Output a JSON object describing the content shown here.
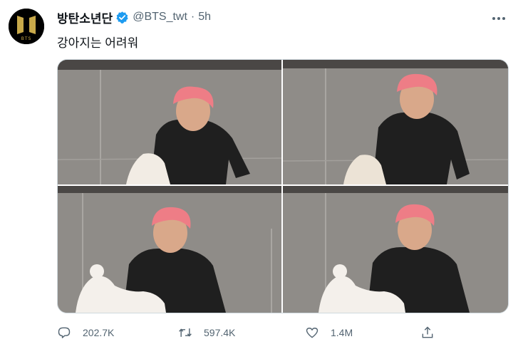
{
  "tweet": {
    "author_name": "방탄소년단",
    "author_handle": "@BTS_twt",
    "separator": "·",
    "timestamp": "5h",
    "text": "강아지는 어려워",
    "avatar_text": "BTS",
    "image_count": 4
  },
  "actions": {
    "reply_count": "202.7K",
    "retweet_count": "597.4K",
    "like_count": "1.4M"
  },
  "colors": {
    "text_primary": "#0f1419",
    "text_secondary": "#536471",
    "verified": "#1d9bf0",
    "border": "#cfd9de",
    "avatar_logo": "#c8a94a"
  }
}
